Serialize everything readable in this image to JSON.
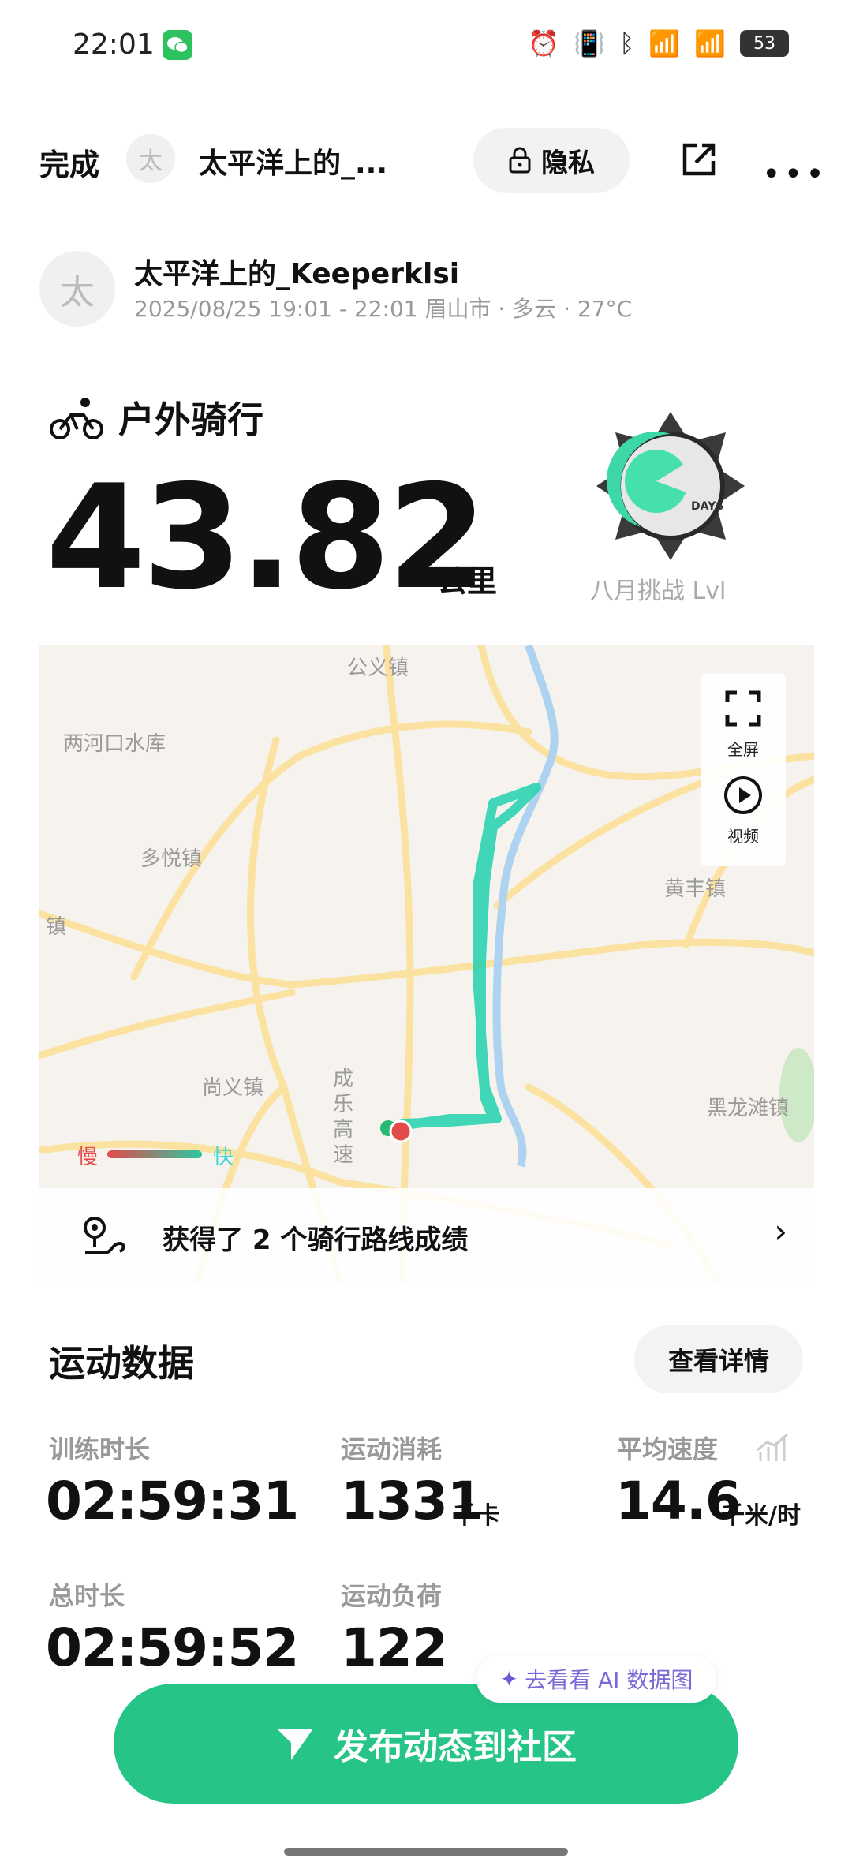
{
  "status_bar": {
    "time": "22:01",
    "battery": "53",
    "icons": [
      "alarm-icon",
      "vibrate-icon",
      "bluetooth-icon",
      "signal-5g-icon",
      "signal-5g-icon"
    ]
  },
  "header": {
    "done_label": "完成",
    "avatar_char": "太",
    "title": "太平洋上的_...",
    "privacy_label": "隐私"
  },
  "user": {
    "avatar_char": "太",
    "name": "太平洋上的_Keeperklsi",
    "meta": "2025/08/25 19:01 - 22:01 眉山市 · 多云 · 27°C"
  },
  "activity": {
    "type": "户外骑行",
    "distance": "43.82",
    "unit": "公里",
    "badge_label": "八月挑战 Lvl",
    "badge_text": "DAYS"
  },
  "map": {
    "labels": {
      "gongyi": "公义镇",
      "lianghekou": "两河口水库",
      "duoyue": "多悦镇",
      "zhen": "镇",
      "shangyi": "尚义镇",
      "chengle": "成乐高速",
      "huangfeng": "黄丰镇",
      "heilongtan": "黑龙滩镇"
    },
    "fullscreen_label": "全屏",
    "video_label": "视频",
    "legend_slow": "慢",
    "legend_fast": "快",
    "route_text": "获得了 2 个骑行路线成绩"
  },
  "stats": {
    "title": "运动数据",
    "details_label": "查看详情",
    "training_duration": {
      "label": "训练时长",
      "value": "02:59:31"
    },
    "calories": {
      "label": "运动消耗",
      "value": "1331",
      "unit": "千卡"
    },
    "avg_speed": {
      "label": "平均速度",
      "value": "14.6",
      "unit": "千米/时"
    },
    "total_duration": {
      "label": "总时长",
      "value": "02:59:52"
    },
    "training_load": {
      "label": "运动负荷",
      "value": "122"
    }
  },
  "cta": {
    "ai_label": "去看看 AI 数据图",
    "publish_label": "发布动态到社区"
  },
  "colors": {
    "accent": "#26c587",
    "route": "#2cd3b0",
    "slow": "#e34b4b",
    "fast": "#3bd7d2"
  }
}
